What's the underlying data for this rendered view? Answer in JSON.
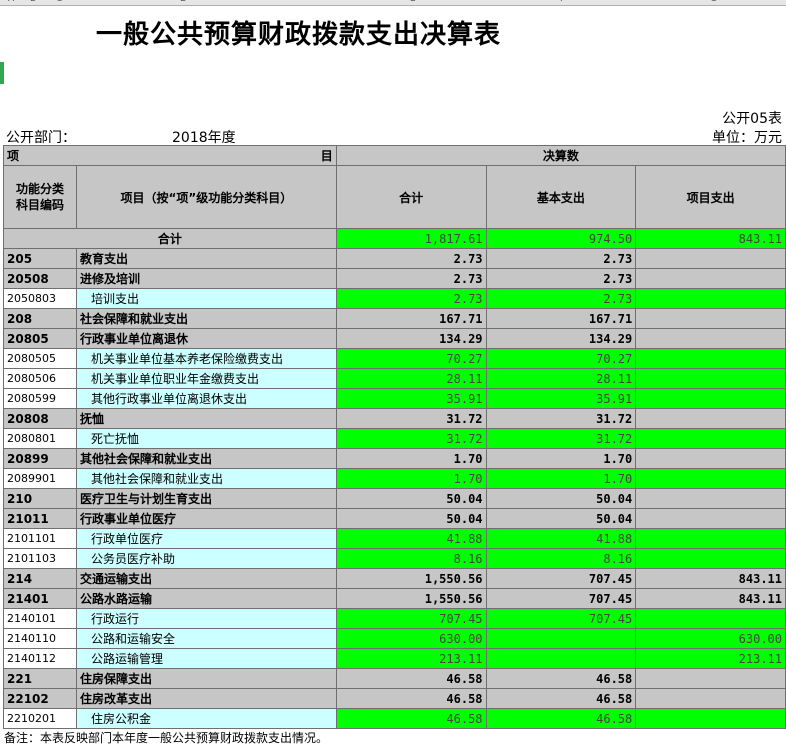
{
  "sheet": {
    "column_letters": [
      "A",
      "B",
      "C",
      "D",
      "E",
      "F",
      "G"
    ],
    "title": "一般公共预算财政拨款支出决算表",
    "form_no": "公开05表",
    "dept_label": "公开部门：",
    "year": "2018年度",
    "unit": "单位：万元"
  },
  "header": {
    "item_label_left": "项",
    "item_label_right": "目",
    "decision_group": "决算数",
    "code_col": "功能分类\n科目编码",
    "name_col": "项目（按“项”级功能分类科目）",
    "total_col": "合计",
    "basic_col": "基本支出",
    "project_col": "项目支出"
  },
  "total_row": {
    "label": "合计",
    "total": "1,817.61",
    "basic": "974.50",
    "project": "843.11"
  },
  "rows": [
    {
      "code": "205",
      "name": "教育支出",
      "total": "2.73",
      "basic": "2.73",
      "project": "",
      "level": "bold"
    },
    {
      "code": "20508",
      "name": "进修及培训",
      "total": "2.73",
      "basic": "2.73",
      "project": "",
      "level": "bold"
    },
    {
      "code": "2050803",
      "name": "培训支出",
      "total": "2.73",
      "basic": "2.73",
      "project": "",
      "level": "leaf"
    },
    {
      "code": "208",
      "name": "社会保障和就业支出",
      "total": "167.71",
      "basic": "167.71",
      "project": "",
      "level": "bold"
    },
    {
      "code": "20805",
      "name": "行政事业单位离退休",
      "total": "134.29",
      "basic": "134.29",
      "project": "",
      "level": "bold"
    },
    {
      "code": "2080505",
      "name": "机关事业单位基本养老保险缴费支出",
      "total": "70.27",
      "basic": "70.27",
      "project": "",
      "level": "leaf"
    },
    {
      "code": "2080506",
      "name": "机关事业单位职业年金缴费支出",
      "total": "28.11",
      "basic": "28.11",
      "project": "",
      "level": "leaf"
    },
    {
      "code": "2080599",
      "name": "其他行政事业单位离退休支出",
      "total": "35.91",
      "basic": "35.91",
      "project": "",
      "level": "leaf"
    },
    {
      "code": "20808",
      "name": "抚恤",
      "total": "31.72",
      "basic": "31.72",
      "project": "",
      "level": "bold"
    },
    {
      "code": "2080801",
      "name": "死亡抚恤",
      "total": "31.72",
      "basic": "31.72",
      "project": "",
      "level": "leaf"
    },
    {
      "code": "20899",
      "name": "其他社会保障和就业支出",
      "total": "1.70",
      "basic": "1.70",
      "project": "",
      "level": "bold"
    },
    {
      "code": "2089901",
      "name": "其他社会保障和就业支出",
      "total": "1.70",
      "basic": "1.70",
      "project": "",
      "level": "leaf"
    },
    {
      "code": "210",
      "name": "医疗卫生与计划生育支出",
      "total": "50.04",
      "basic": "50.04",
      "project": "",
      "level": "bold"
    },
    {
      "code": "21011",
      "name": "行政事业单位医疗",
      "total": "50.04",
      "basic": "50.04",
      "project": "",
      "level": "bold"
    },
    {
      "code": "2101101",
      "name": "行政单位医疗",
      "total": "41.88",
      "basic": "41.88",
      "project": "",
      "level": "leaf"
    },
    {
      "code": "2101103",
      "name": "公务员医疗补助",
      "total": "8.16",
      "basic": "8.16",
      "project": "",
      "level": "leaf"
    },
    {
      "code": "214",
      "name": "交通运输支出",
      "total": "1,550.56",
      "basic": "707.45",
      "project": "843.11",
      "level": "bold"
    },
    {
      "code": "21401",
      "name": "公路水路运输",
      "total": "1,550.56",
      "basic": "707.45",
      "project": "843.11",
      "level": "bold"
    },
    {
      "code": "2140101",
      "name": "行政运行",
      "total": "707.45",
      "basic": "707.45",
      "project": "",
      "level": "leaf"
    },
    {
      "code": "2140110",
      "name": "公路和运输安全",
      "total": "630.00",
      "basic": "",
      "project": "630.00",
      "level": "leaf"
    },
    {
      "code": "2140112",
      "name": "公路运输管理",
      "total": "213.11",
      "basic": "",
      "project": "213.11",
      "level": "leaf"
    },
    {
      "code": "221",
      "name": "住房保障支出",
      "total": "46.58",
      "basic": "46.58",
      "project": "",
      "level": "bold"
    },
    {
      "code": "22102",
      "name": "住房改革支出",
      "total": "46.58",
      "basic": "46.58",
      "project": "",
      "level": "bold"
    },
    {
      "code": "2210201",
      "name": "住房公积金",
      "total": "46.58",
      "basic": "46.58",
      "project": "",
      "level": "leaf"
    }
  ],
  "note": "备注：本表反映部门本年度一般公共预算财政拨款支出情况。",
  "colors": {
    "header_gray": "#c6c6c6",
    "leaf_cyan": "#ccffff",
    "value_green": "#00ff00"
  }
}
